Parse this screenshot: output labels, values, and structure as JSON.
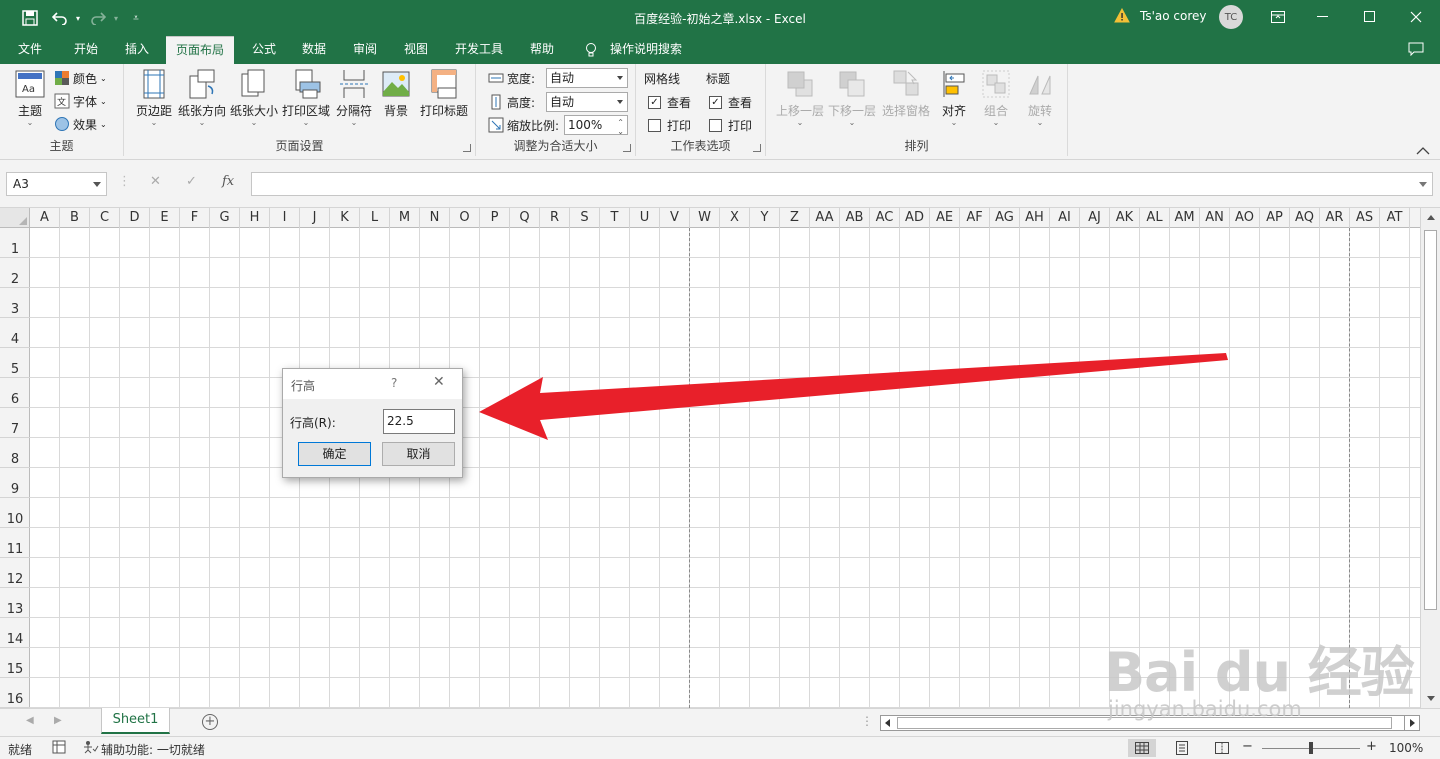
{
  "window": {
    "title": "百度经验-初始之章.xlsx  -  Excel",
    "user_name": "Ts'ao corey",
    "user_initials": "TC"
  },
  "tabs": [
    "文件",
    "开始",
    "插入",
    "页面布局",
    "公式",
    "数据",
    "审阅",
    "视图",
    "开发工具",
    "帮助",
    "操作说明搜索"
  ],
  "ribbon": {
    "themes": {
      "theme": "主题",
      "colors": "颜色",
      "fonts": "字体",
      "effects": "效果",
      "label": "主题"
    },
    "page_setup": {
      "margins": "页边距",
      "orientation": "纸张方向",
      "size": "纸张大小",
      "print_area": "打印区域",
      "breaks": "分隔符",
      "background": "背景",
      "print_titles": "打印标题",
      "label": "页面设置"
    },
    "scale": {
      "width_label": "宽度:",
      "width_value": "自动",
      "height_label": "高度:",
      "height_value": "自动",
      "scale_label": "缩放比例:",
      "scale_value": "100%",
      "label": "调整为合适大小"
    },
    "sheet_options": {
      "gridlines": "网格线",
      "headings": "标题",
      "view": "查看",
      "print": "打印",
      "label": "工作表选项"
    },
    "arrange": {
      "bring_forward": "上移一层",
      "send_backward": "下移一层",
      "selection_pane": "选择窗格",
      "align": "对齐",
      "group": "组合",
      "rotate": "旋转",
      "label": "排列"
    }
  },
  "formula_bar": {
    "name_box": "A3",
    "fx": "fx",
    "cancel": "✕",
    "enter": "✓"
  },
  "grid": {
    "columns": [
      "A",
      "B",
      "C",
      "D",
      "E",
      "F",
      "G",
      "H",
      "I",
      "J",
      "K",
      "L",
      "M",
      "N",
      "O",
      "P",
      "Q",
      "R",
      "S",
      "T",
      "U",
      "V",
      "W",
      "X",
      "Y",
      "Z",
      "AA",
      "AB",
      "AC",
      "AD",
      "AE",
      "AF",
      "AG",
      "AH",
      "AI",
      "AJ",
      "AK",
      "AL",
      "AM",
      "AN",
      "AO",
      "AP",
      "AQ",
      "AR",
      "AS",
      "AT"
    ],
    "rows": [
      "1",
      "2",
      "3",
      "4",
      "5",
      "6",
      "7",
      "8",
      "9",
      "10",
      "11",
      "12",
      "13",
      "14",
      "15",
      "16"
    ]
  },
  "dialog": {
    "title": "行高",
    "help": "?",
    "close": "✕",
    "field_label": "行高(R):",
    "field_value": "22.5",
    "ok": "确定",
    "cancel": "取消"
  },
  "sheets": [
    "Sheet1"
  ],
  "status": {
    "ready": "就绪",
    "accessibility": "辅助功能: 一切就绪",
    "zoom": "100%"
  },
  "watermark": {
    "brand": "Bai du 经验",
    "url": "jingyan.baidu.com"
  },
  "colors": {
    "accent": "#217346",
    "arrow": "#e8202a"
  }
}
